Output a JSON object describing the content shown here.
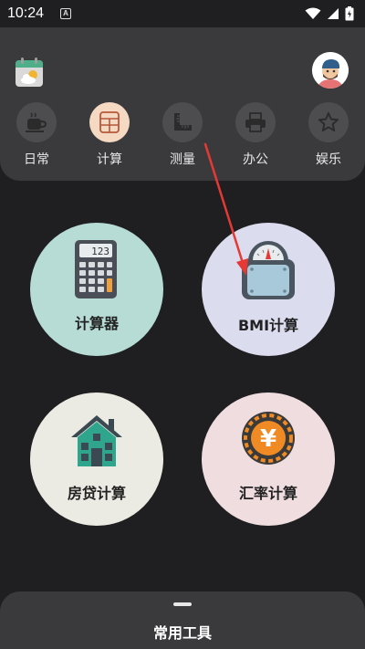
{
  "status_bar": {
    "time": "10:24",
    "notification_glyph": "A"
  },
  "categories": [
    {
      "label": "日常",
      "icon": "coffee-icon",
      "active": false
    },
    {
      "label": "计算",
      "icon": "calculator-icon",
      "active": true
    },
    {
      "label": "测量",
      "icon": "ruler-icon",
      "active": false
    },
    {
      "label": "办公",
      "icon": "printer-icon",
      "active": false
    },
    {
      "label": "娱乐",
      "icon": "star-icon",
      "active": false
    }
  ],
  "tools": [
    {
      "label": "计算器",
      "icon": "calculator-icon",
      "bg": "#b7dcd6",
      "display": "123"
    },
    {
      "label": "BMI计算",
      "icon": "scale-icon",
      "bg": "#dcdcef"
    },
    {
      "label": "房贷计算",
      "icon": "house-icon",
      "bg": "#ecebe3"
    },
    {
      "label": "汇率计算",
      "icon": "yuan-coin-icon",
      "bg": "#f0dde0",
      "symbol": "¥"
    }
  ],
  "bottom_sheet": {
    "title": "常用工具"
  },
  "colors": {
    "background": "#1f1f21",
    "panel": "#3a3a3c",
    "active_category": "#f5d9c3",
    "annotation_arrow": "#e53935"
  }
}
